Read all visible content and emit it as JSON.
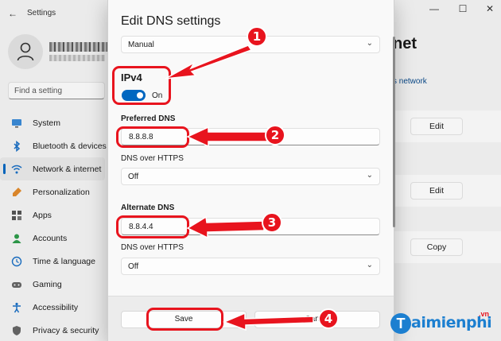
{
  "window": {
    "back_icon": "back-arrow-icon",
    "title": "Settings",
    "controls": {
      "minimize": "—",
      "maximize": "☐",
      "close": "✕"
    }
  },
  "sidebar": {
    "search_placeholder": "Find a setting",
    "items": [
      {
        "label": "System",
        "icon": "monitor-icon"
      },
      {
        "label": "Bluetooth & devices",
        "icon": "bluetooth-icon"
      },
      {
        "label": "Network & internet",
        "icon": "wifi-icon",
        "active": true
      },
      {
        "label": "Personalization",
        "icon": "brush-icon"
      },
      {
        "label": "Apps",
        "icon": "apps-icon"
      },
      {
        "label": "Accounts",
        "icon": "person-icon"
      },
      {
        "label": "Time & language",
        "icon": "clock-globe-icon"
      },
      {
        "label": "Gaming",
        "icon": "gamepad-icon"
      },
      {
        "label": "Accessibility",
        "icon": "accessibility-icon"
      },
      {
        "label": "Privacy & security",
        "icon": "shield-icon"
      }
    ]
  },
  "background": {
    "title_fragment": "net",
    "link_fragment": "s network",
    "buttons": [
      "Edit",
      "Edit",
      "Copy"
    ]
  },
  "dialog": {
    "title": "Edit DNS settings",
    "mode": "Manual",
    "ipv4_label": "IPv4",
    "toggle_state": "On",
    "toggle_on": true,
    "preferred_label": "Preferred DNS",
    "preferred_value": "8.8.8.8",
    "preferred_https_label": "DNS over HTTPS",
    "preferred_https_value": "Off",
    "alternate_label": "Alternate DNS",
    "alternate_value": "8.8.4.4",
    "alternate_https_label": "DNS over HTTPS",
    "alternate_https_value": "Off",
    "save_label": "Save",
    "cancel_label": "Cancel"
  },
  "annotations": {
    "color": "#e8141e",
    "steps": [
      "1",
      "2",
      "3",
      "4"
    ]
  },
  "watermark": {
    "logo_letter": "T",
    "text": "aimienphi",
    "suffix": ".vn"
  }
}
